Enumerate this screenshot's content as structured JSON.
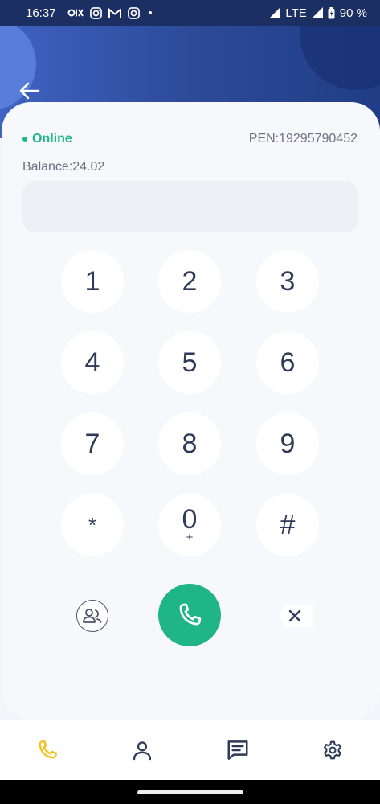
{
  "status_bar": {
    "time": "16:37",
    "notification_icons": [
      "olx-icon",
      "instagram-icon",
      "gmail-icon",
      "instagram-icon",
      "dot-icon"
    ],
    "network": "LTE",
    "battery": "90 %"
  },
  "header": {
    "back_icon": "arrow-left-icon"
  },
  "account": {
    "status": "Online",
    "status_color": "#1eb787",
    "pen": "PEN:19295790452",
    "balance": "Balance:24.02"
  },
  "dialer": {
    "number_value": "",
    "keys": [
      {
        "label": "1",
        "sub": ""
      },
      {
        "label": "2",
        "sub": ""
      },
      {
        "label": "3",
        "sub": ""
      },
      {
        "label": "4",
        "sub": ""
      },
      {
        "label": "5",
        "sub": ""
      },
      {
        "label": "6",
        "sub": ""
      },
      {
        "label": "7",
        "sub": ""
      },
      {
        "label": "8",
        "sub": ""
      },
      {
        "label": "9",
        "sub": ""
      },
      {
        "label": "*",
        "sub": ""
      },
      {
        "label": "0",
        "sub": "+"
      },
      {
        "label": "#",
        "sub": ""
      }
    ],
    "actions": {
      "contacts_icon": "contacts-icon",
      "call_icon": "phone-icon",
      "call_color": "#1fb584",
      "delete_icon": "backspace-icon"
    }
  },
  "tab_bar": {
    "tabs": [
      {
        "icon": "phone-icon",
        "active": true,
        "color": "#f2c31b"
      },
      {
        "icon": "user-icon",
        "active": false
      },
      {
        "icon": "message-icon",
        "active": false
      },
      {
        "icon": "settings-icon",
        "active": false
      }
    ]
  }
}
